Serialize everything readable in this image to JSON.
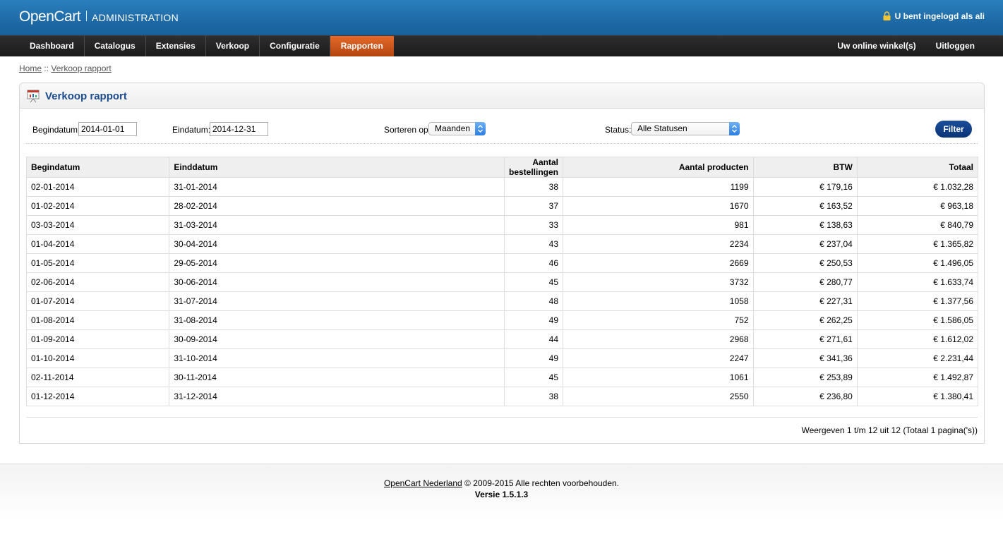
{
  "header": {
    "logo": "OpenCart",
    "admin": "ADMINISTRATION",
    "login_text": "U bent ingelogd als ali"
  },
  "menu": {
    "left": [
      "Dashboard",
      "Catalogus",
      "Extensies",
      "Verkoop",
      "Configuratie",
      "Rapporten"
    ],
    "active": "Rapporten",
    "right": [
      "Uw online winkel(s)",
      "Uitloggen"
    ]
  },
  "breadcrumb": {
    "home": "Home",
    "sep": " :: ",
    "current": "Verkoop rapport"
  },
  "page": {
    "title": "Verkoop rapport"
  },
  "filter": {
    "start_label": "Begindatum:",
    "start_value": "2014-01-01",
    "end_label": "Eindatum:",
    "end_value": "2014-12-31",
    "sort_label": "Sorteren op:",
    "sort_value": "Maanden",
    "status_label": "Status:",
    "status_value": "Alle Statusen",
    "button": "Filter"
  },
  "table": {
    "headers": [
      "Begindatum",
      "Einddatum",
      "Aantal bestellingen",
      "Aantal producten",
      "BTW",
      "Totaal"
    ],
    "rows": [
      [
        "02-01-2014",
        "31-01-2014",
        "38",
        "1199",
        "€ 179,16",
        "€ 1.032,28"
      ],
      [
        "01-02-2014",
        "28-02-2014",
        "37",
        "1670",
        "€ 163,52",
        "€ 963,18"
      ],
      [
        "03-03-2014",
        "31-03-2014",
        "33",
        "981",
        "€ 138,63",
        "€ 840,79"
      ],
      [
        "01-04-2014",
        "30-04-2014",
        "43",
        "2234",
        "€ 237,04",
        "€ 1.365,82"
      ],
      [
        "01-05-2014",
        "29-05-2014",
        "46",
        "2669",
        "€ 250,53",
        "€ 1.496,05"
      ],
      [
        "02-06-2014",
        "30-06-2014",
        "45",
        "3732",
        "€ 280,77",
        "€ 1.633,74"
      ],
      [
        "01-07-2014",
        "31-07-2014",
        "48",
        "1058",
        "€ 227,31",
        "€ 1.377,56"
      ],
      [
        "01-08-2014",
        "31-08-2014",
        "49",
        "752",
        "€ 262,25",
        "€ 1.586,05"
      ],
      [
        "01-09-2014",
        "30-09-2014",
        "44",
        "2968",
        "€ 271,61",
        "€ 1.612,02"
      ],
      [
        "01-10-2014",
        "31-10-2014",
        "49",
        "2247",
        "€ 341,36",
        "€ 2.231,44"
      ],
      [
        "02-11-2014",
        "30-11-2014",
        "45",
        "1061",
        "€ 253,89",
        "€ 1.492,87"
      ],
      [
        "01-12-2014",
        "31-12-2014",
        "38",
        "2550",
        "€ 236,80",
        "€ 1.380,41"
      ]
    ]
  },
  "pagination": "Weergeven 1 t/m 12 uit 12 (Totaal 1 pagina('s))",
  "footer": {
    "link": "OpenCart Nederland",
    "copyright": " © 2009-2015 Alle rechten voorbehouden.",
    "version": "Versie 1.5.1.3"
  }
}
